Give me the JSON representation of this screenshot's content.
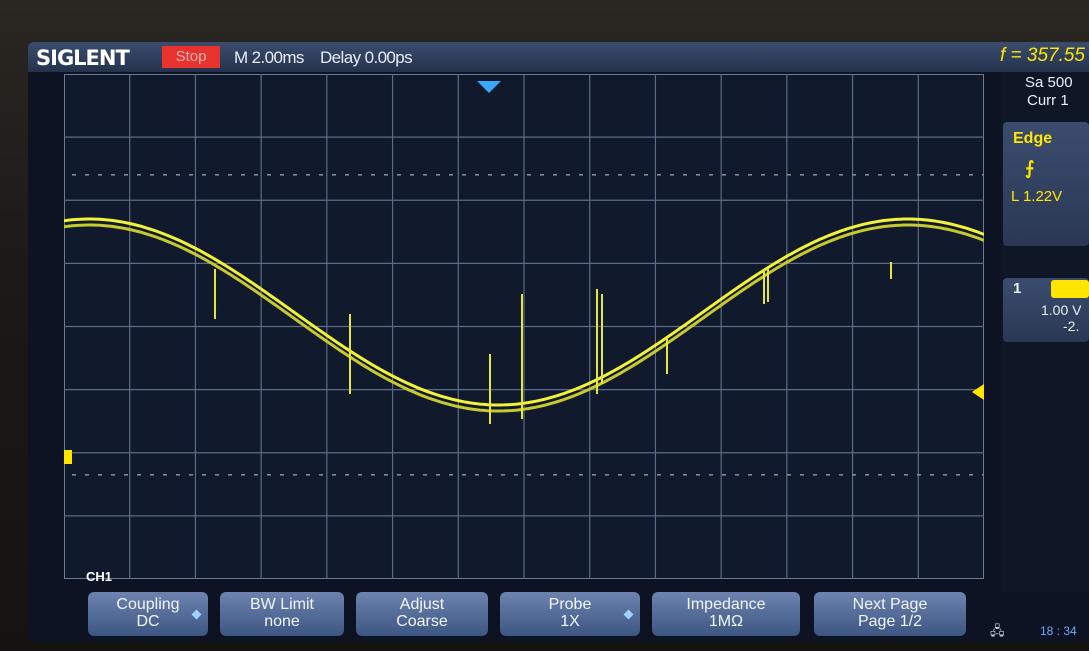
{
  "header": {
    "brand": "SIGLENT",
    "run_state": "Stop",
    "timebase": "M 2.00ms",
    "delay": "Delay 0.00ps",
    "frequency": "f = 357.55"
  },
  "right_panel": {
    "sample_rate": "Sa 500",
    "current": "Curr 1",
    "trigger_mode": "Edge",
    "trigger_level": "L  1.22V",
    "channel_tab": "1",
    "channel_scale": "1.00 V",
    "channel_offset": "-2."
  },
  "channel_label": "CH1",
  "softkeys": [
    {
      "line1": "Coupling",
      "line2": "DC"
    },
    {
      "line1": "BW Limit",
      "line2": "none"
    },
    {
      "line1": "Adjust",
      "line2": "Coarse"
    },
    {
      "line1": "Probe",
      "line2": "1X"
    },
    {
      "line1": "Impedance",
      "line2": "1MΩ"
    },
    {
      "line1": "Next Page",
      "line2": "Page 1/2"
    }
  ],
  "clock": "18 : 34",
  "colors": {
    "trace": "#f2f23a",
    "accent_red": "#e8322e",
    "bar_blue": "#3b4c6e",
    "level_marker": "#ffe500"
  }
}
